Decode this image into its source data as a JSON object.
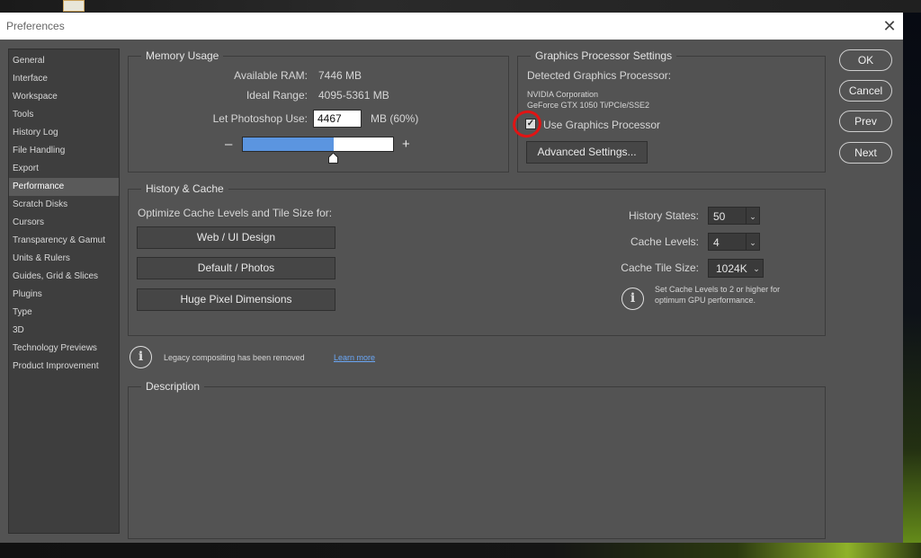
{
  "window": {
    "title": "Preferences",
    "close_glyph": "✕"
  },
  "sidebar": {
    "items": [
      {
        "label": "General"
      },
      {
        "label": "Interface"
      },
      {
        "label": "Workspace"
      },
      {
        "label": "Tools"
      },
      {
        "label": "History Log"
      },
      {
        "label": "File Handling"
      },
      {
        "label": "Export"
      },
      {
        "label": "Performance",
        "active": true
      },
      {
        "label": "Scratch Disks"
      },
      {
        "label": "Cursors"
      },
      {
        "label": "Transparency & Gamut"
      },
      {
        "label": "Units & Rulers"
      },
      {
        "label": "Guides, Grid & Slices"
      },
      {
        "label": "Plugins"
      },
      {
        "label": "Type"
      },
      {
        "label": "3D"
      },
      {
        "label": "Technology Previews"
      },
      {
        "label": "Product Improvement"
      }
    ]
  },
  "memory": {
    "title": "Memory Usage",
    "available_label": "Available RAM:",
    "available_value": "7446 MB",
    "ideal_label": "Ideal Range:",
    "ideal_value": "4095-5361 MB",
    "use_label": "Let Photoshop Use:",
    "use_value": "4467",
    "use_unit": "MB (60%)",
    "slider_fraction": 0.6,
    "minus": "–",
    "plus": "+"
  },
  "gpu": {
    "title": "Graphics Processor Settings",
    "detected_label": "Detected Graphics Processor:",
    "vendor": "NVIDIA Corporation",
    "model": "GeForce GTX 1050 Ti/PCIe/SSE2",
    "use_gpu_label": "Use Graphics Processor",
    "use_gpu_checked": true,
    "check_glyph": "✓",
    "advanced_button": "Advanced Settings..."
  },
  "cache": {
    "title": "History & Cache",
    "optimize_label": "Optimize Cache Levels and Tile Size for:",
    "btn_web": "Web / UI Design",
    "btn_default": "Default / Photos",
    "btn_huge": "Huge Pixel Dimensions",
    "history_states_label": "History States:",
    "history_states_value": "50",
    "cache_levels_label": "Cache Levels:",
    "cache_levels_value": "4",
    "tile_size_label": "Cache Tile Size:",
    "tile_size_value": "1024K",
    "hint_line1": "Set Cache Levels to 2 or higher for",
    "hint_line2": "optimum GPU performance.",
    "chevron": "⌄"
  },
  "legacy": {
    "text": "Legacy compositing has been removed",
    "link": "Learn more",
    "icon_glyph": "i"
  },
  "description": {
    "title": "Description"
  },
  "actions": {
    "ok": "OK",
    "cancel": "Cancel",
    "prev": "Prev",
    "next": "Next"
  },
  "colors": {
    "accent": "#5b95e0",
    "highlight": "#e11414",
    "link": "#6aa6f5"
  }
}
